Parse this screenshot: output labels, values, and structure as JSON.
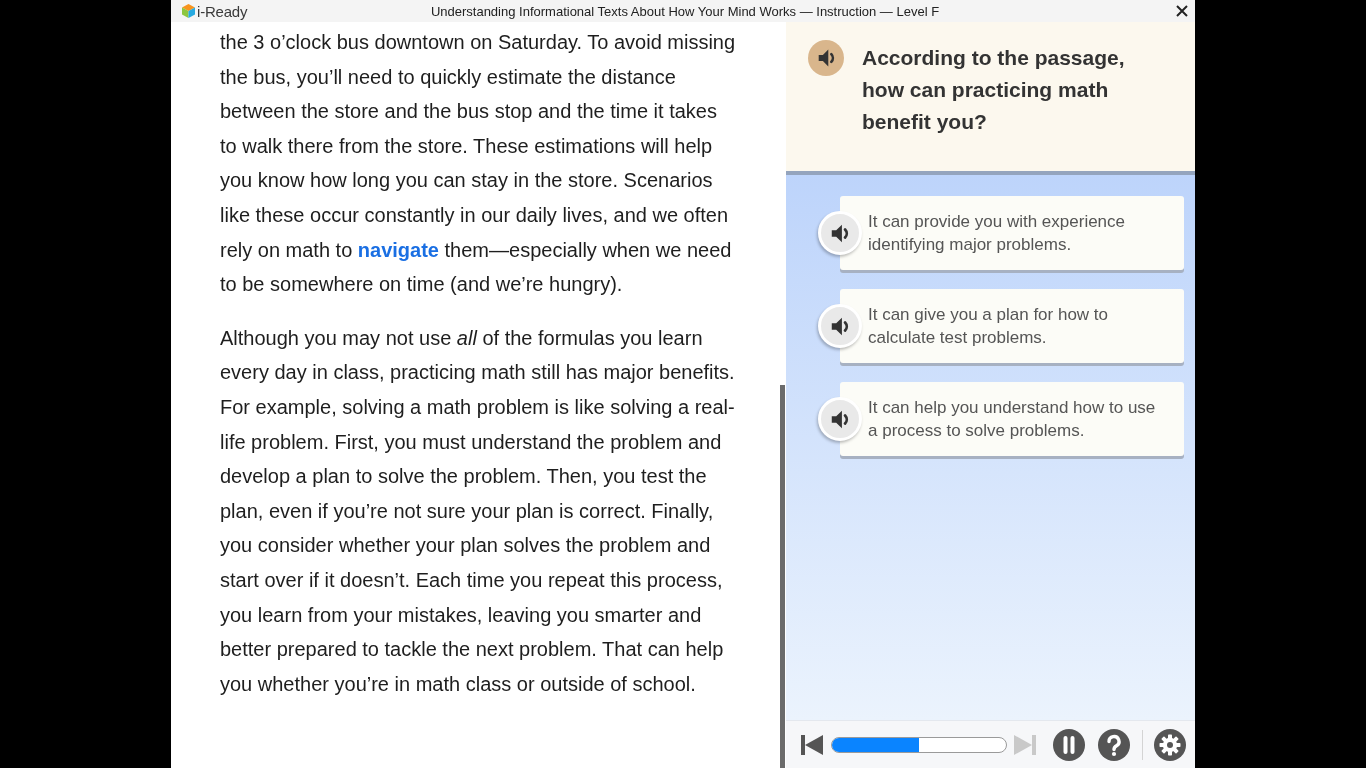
{
  "window": {
    "app_name": "i-Ready",
    "title": "Understanding Informational Texts About How Your Mind Works — Instruction — Level F"
  },
  "passage": {
    "paragraphs": [
      {
        "runs": [
          {
            "kind": "text",
            "text": "the 3 o’clock bus downtown on Saturday. To avoid missing the bus, you’ll need to quickly estimate the distance between the store and the bus stop and the time it takes to walk there from the store. These estimations will help you know how long you can stay in the store. Scenarios like these occur constantly in our daily lives, and we often rely on math to "
          },
          {
            "kind": "link",
            "text": "navigate"
          },
          {
            "kind": "text",
            "text": " them—especially when we need to be somewhere on time (and we’re hungry)."
          }
        ]
      },
      {
        "runs": [
          {
            "kind": "text",
            "text": "Although you may not use *all* of the formulas you learn every day in class, practicing math still has major benefits. For example, solving a math problem is like solving a real-life problem. First, you must understand the problem and develop a plan to solve the problem. Then, you test the plan, even if you’re not sure your plan is correct. Finally, you consider whether your plan solves the problem and start over if it doesn’t. Each time you repeat this process, you learn from your mistakes, leaving you smarter and better prepared to tackle the next problem. That can help you whether you’re in math class or outside of school."
          }
        ]
      }
    ]
  },
  "question": {
    "text": "According to the passage, how can practicing math benefit you?"
  },
  "answers": [
    {
      "text": "It can provide you with experience identifying major problems."
    },
    {
      "text": "It can give you a plan for how to calculate test problems."
    },
    {
      "text": "It can help you understand how to use a process to solve problems."
    }
  ],
  "toolbar": {
    "items": [
      {
        "kind": "previous",
        "disabled": false
      },
      {
        "kind": "progress",
        "level": 0.5
      },
      {
        "kind": "next",
        "disabled": true
      },
      {
        "kind": "pause",
        "disabled": false
      },
      {
        "kind": "help",
        "disabled": false
      },
      {
        "kind": "settings",
        "disabled": false
      }
    ]
  }
}
